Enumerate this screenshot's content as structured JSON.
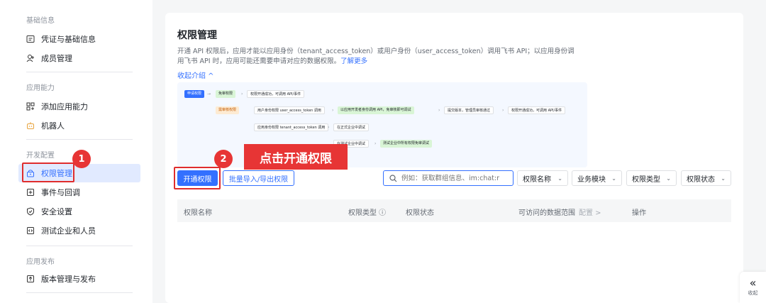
{
  "sidebar": {
    "sections": [
      {
        "title": "基础信息",
        "items": [
          {
            "label": "凭证与基础信息"
          },
          {
            "label": "成员管理"
          }
        ]
      },
      {
        "title": "应用能力",
        "items": [
          {
            "label": "添加应用能力"
          },
          {
            "label": "机器人"
          }
        ]
      },
      {
        "title": "开发配置",
        "items": [
          {
            "label": "权限管理"
          },
          {
            "label": "事件与回调"
          },
          {
            "label": "安全设置"
          },
          {
            "label": "测试企业和人员"
          }
        ]
      },
      {
        "title": "应用发布",
        "items": [
          {
            "label": "版本管理与发布"
          }
        ]
      }
    ],
    "active_item": "权限管理"
  },
  "annotations": {
    "step1": "1",
    "step2": "2",
    "callout": "点击开通权限"
  },
  "main": {
    "title": "权限管理",
    "desc_line1": "开通 API 权限后，应用才能以应用身份（tenant_access_token）或用户身份（user_access_token）调用飞书 API；以应用身份调",
    "desc_line2": "用飞书 API 时，应用可能还需要申请对应的数据权限。",
    "learn_more": "了解更多",
    "collapse": "收起介绍 ^",
    "flow": {
      "apply": "申请权限",
      "no_review": "免审权限",
      "no_review_result": "权限开通成功，可调用 API/事件",
      "need_review": "需审核权限",
      "user_identity": "用户身份权限 user_access_token 调用",
      "user_result": "以应用开发者身份调用 API，免审核即可调试",
      "submit": "提交版本，管理员审核通过",
      "final_result": "权限开通成功，可调用 API/事件",
      "app_identity": "应用身份权限 tenant_access_token 调用",
      "formal_debug": "在正式企业中调试",
      "test_debug": "在测试企业中调试",
      "test_result": "测试企业中所有权限免审调试"
    },
    "toolbar": {
      "enable_btn": "开通权限",
      "batch_btn": "批量导入/导出权限",
      "search_placeholder": "例如：获取群组信息、im:chat:r",
      "filters": [
        "权限名称",
        "业务模块",
        "权限类型",
        "权限状态"
      ]
    },
    "table": {
      "columns": [
        "权限名称",
        "权限类型 ⓘ",
        "权限状态",
        "可访问的数据范围",
        "配置 >",
        "操作"
      ]
    }
  },
  "collapse_button": {
    "icon": "double-chevron-left-icon",
    "label": "收起"
  },
  "colors": {
    "accent": "#3370ff",
    "highlight": "#e73535"
  }
}
